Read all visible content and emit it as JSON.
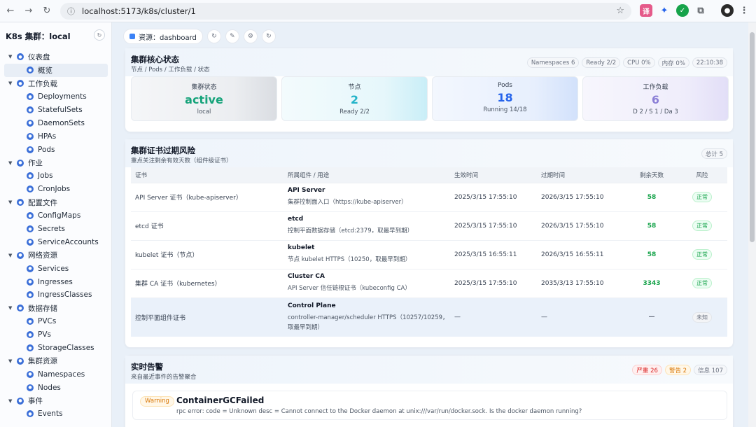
{
  "browser": {
    "url": "localhost:5173/k8s/cluster/1"
  },
  "sidebar": {
    "title": "K8s 集群：local",
    "groups": [
      {
        "label": "仪表盘",
        "items": [
          "概览"
        ]
      },
      {
        "label": "工作负载",
        "items": [
          "Deployments",
          "StatefulSets",
          "DaemonSets",
          "HPAs",
          "Pods"
        ]
      },
      {
        "label": "作业",
        "items": [
          "Jobs",
          "CronJobs"
        ]
      },
      {
        "label": "配置文件",
        "items": [
          "ConfigMaps",
          "Secrets",
          "ServiceAccounts"
        ]
      },
      {
        "label": "网络资源",
        "items": [
          "Services",
          "Ingresses",
          "IngressClasses"
        ]
      },
      {
        "label": "数据存储",
        "items": [
          "PVCs",
          "PVs",
          "StorageClasses"
        ]
      },
      {
        "label": "集群资源",
        "items": [
          "Namespaces",
          "Nodes"
        ]
      },
      {
        "label": "事件",
        "items": [
          "Events"
        ]
      }
    ]
  },
  "topbar": {
    "resource": "资源：dashboard"
  },
  "core": {
    "title": "集群核心状态",
    "subtitle": "节点 / Pods / 工作负载 / 状态",
    "chips": [
      "Namespaces 6",
      "Ready 2/2",
      "CPU 0%",
      "内存 0%",
      "22:10:38"
    ],
    "stats": [
      {
        "label": "集群状态",
        "value": "active",
        "sub": "local",
        "color": "#16a37a"
      },
      {
        "label": "节点",
        "value": "2",
        "sub": "Ready 2/2",
        "color": "#22b3c9"
      },
      {
        "label": "Pods",
        "value": "18",
        "sub": "Running 14/18",
        "color": "#2563eb"
      },
      {
        "label": "工作负载",
        "value": "6",
        "sub": "D 2 / S 1 / Da 3",
        "color": "#8b7fd6"
      }
    ]
  },
  "certs": {
    "title": "集群证书过期风险",
    "subtitle": "重点关注剩余有效天数（组件级证书）",
    "total": "总计 5",
    "headers": [
      "证书",
      "所属组件 / 用途",
      "生效时间",
      "过期时间",
      "剩余天数",
      "风险"
    ],
    "rows": [
      {
        "cert": "API Server 证书（kube-apiserver）",
        "comp": "API Server",
        "desc": "集群控制面入口（https://kube-apiserver）",
        "start": "2025/3/15 17:55:10",
        "end": "2026/3/15 17:55:10",
        "days": "58",
        "risk": "正常"
      },
      {
        "cert": "etcd 证书",
        "comp": "etcd",
        "desc": "控制平面数据存储（etcd:2379，取最早到期）",
        "start": "2025/3/15 17:55:10",
        "end": "2026/3/15 17:55:10",
        "days": "58",
        "risk": "正常"
      },
      {
        "cert": "kubelet 证书（节点）",
        "comp": "kubelet",
        "desc": "节点 kubelet HTTPS（10250，取最早到期）",
        "start": "2025/3/15 16:55:11",
        "end": "2026/3/15 16:55:11",
        "days": "58",
        "risk": "正常"
      },
      {
        "cert": "集群 CA 证书（kubernetes）",
        "comp": "Cluster CA",
        "desc": "API Server 信任链根证书（kubeconfig CA）",
        "start": "2025/3/15 17:55:10",
        "end": "2035/3/13 17:55:10",
        "days": "3343",
        "risk": "正常"
      },
      {
        "cert": "控制平面组件证书",
        "comp": "Control Plane",
        "desc": "controller-manager/scheduler HTTPS（10257/10259，取最早到期）",
        "start": "—",
        "end": "—",
        "days": "—",
        "risk": "未知"
      }
    ]
  },
  "alerts": {
    "title": "实时告警",
    "subtitle": "来自最近事件的告警聚合",
    "chips": {
      "severe": "严重 26",
      "warning": "警告 2",
      "info": "信息 107"
    },
    "item": {
      "level": "Warning",
      "name": "ContainerGCFailed",
      "message": "rpc error: code = Unknown desc = Cannot connect to the Docker daemon at unix:///var/run/docker.sock. Is the docker daemon running?"
    }
  }
}
